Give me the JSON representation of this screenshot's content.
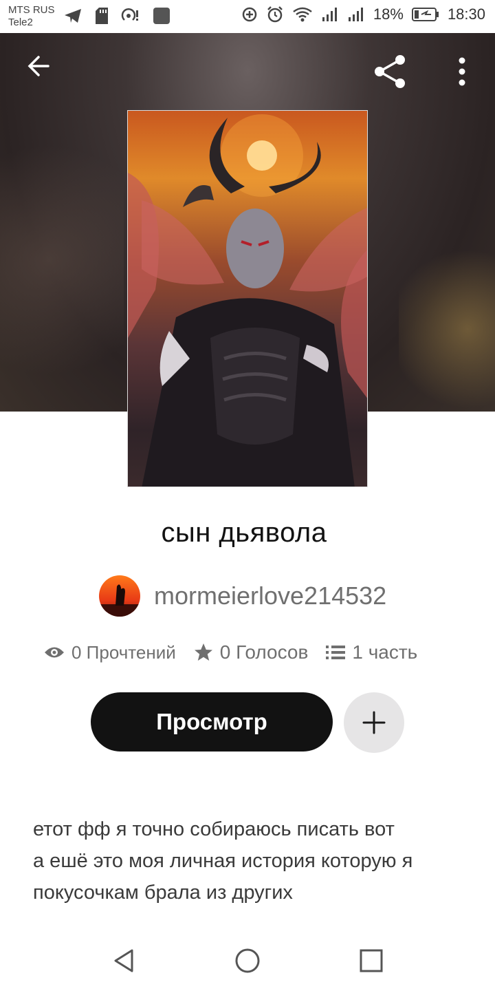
{
  "status_bar": {
    "carrier_1": "MTS RUS",
    "carrier_2": "Tele2",
    "battery": "18%",
    "time": "18:30",
    "left_icons": [
      "telegram-icon",
      "sd-card-icon",
      "hotspot-icon",
      "app-icon"
    ],
    "right_icons": [
      "data-saver-icon",
      "alarm-icon",
      "wifi-icon",
      "signal-icon",
      "signal-icon",
      "battery-icon"
    ]
  },
  "toolbar": {
    "back_icon": "arrow-left-icon",
    "share_icon": "share-icon",
    "more_icon": "more-vertical-icon"
  },
  "story": {
    "title": "сын дьявола",
    "author": "mormeierlove214532",
    "reads": "0 Прочтений",
    "votes": "0 Голосов",
    "parts": "1 часть",
    "read_button": "Просмотр",
    "description_lines": [
      "етот фф я точно собираюсь писать вот",
      "а ешё это моя личная история которую я",
      "покусочкам брала из других"
    ]
  },
  "colors": {
    "primary_button": "#121212",
    "secondary_button": "#e6e5e6",
    "muted_text": "#6f6f6f"
  },
  "navbar": {
    "icons": [
      "back-triangle-icon",
      "home-circle-icon",
      "recents-square-icon"
    ]
  }
}
